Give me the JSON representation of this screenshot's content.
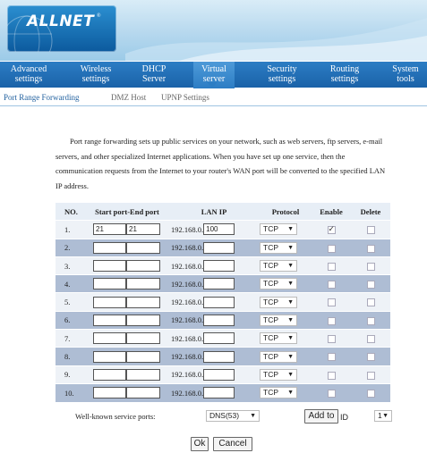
{
  "brand": {
    "name": "ALLNET",
    "reg": "®"
  },
  "nav": [
    {
      "line1": "Advanced",
      "line2": "settings"
    },
    {
      "line1": "Wireless",
      "line2": "settings"
    },
    {
      "line1": "DHCP",
      "line2": "Server"
    },
    {
      "line1": "Virtual",
      "line2": "server"
    },
    {
      "line1": "Security",
      "line2": "settings"
    },
    {
      "line1": "Routing",
      "line2": "settings"
    },
    {
      "line1": "System",
      "line2": "tools"
    }
  ],
  "subtabs": [
    "Port Range Forwarding",
    "DMZ Host",
    "UPNP Settings"
  ],
  "description": "Port range forwarding sets up public services on your network, such as web servers, ftp servers, e-mail servers, and other specialized Internet applications. When you have set up one service, then the communication requests from the Internet to your router's WAN port will be converted to the specified LAN IP address.",
  "table": {
    "headers": {
      "no": "NO.",
      "ports": "Start port-End port",
      "lan_ip": "LAN IP",
      "protocol": "Protocol",
      "enable": "Enable",
      "delete": "Delete"
    },
    "ip_prefix": "192.168.0.",
    "rows": [
      {
        "no": "1.",
        "start": "21",
        "end": "21",
        "ip": "100",
        "protocol": "TCP",
        "enabled": true
      },
      {
        "no": "2.",
        "start": "",
        "end": "",
        "ip": "",
        "protocol": "TCP",
        "enabled": false
      },
      {
        "no": "3.",
        "start": "",
        "end": "",
        "ip": "",
        "protocol": "TCP",
        "enabled": false
      },
      {
        "no": "4.",
        "start": "",
        "end": "",
        "ip": "",
        "protocol": "TCP",
        "enabled": false
      },
      {
        "no": "5.",
        "start": "",
        "end": "",
        "ip": "",
        "protocol": "TCP",
        "enabled": false
      },
      {
        "no": "6.",
        "start": "",
        "end": "",
        "ip": "",
        "protocol": "TCP",
        "enabled": false
      },
      {
        "no": "7.",
        "start": "",
        "end": "",
        "ip": "",
        "protocol": "TCP",
        "enabled": false
      },
      {
        "no": "8.",
        "start": "",
        "end": "",
        "ip": "",
        "protocol": "TCP",
        "enabled": false
      },
      {
        "no": "9.",
        "start": "",
        "end": "",
        "ip": "",
        "protocol": "TCP",
        "enabled": false
      },
      {
        "no": "10.",
        "start": "",
        "end": "",
        "ip": "",
        "protocol": "TCP",
        "enabled": false
      }
    ]
  },
  "well_known": {
    "label": "Well-known service ports:",
    "selected": "DNS(53)"
  },
  "add_button": "Add to",
  "id_label": "ID",
  "id_selected": "1",
  "ok_button": "Ok",
  "cancel_button": "Cancel",
  "icons": {
    "dropdown": "chevron-down-icon",
    "checkbox": "checkbox-icon"
  },
  "colors": {
    "nav_bg": "#1a62a8",
    "row_dark": "#aebdd4",
    "row_light": "#eef2f7",
    "active_subtab": "#1f5f9e"
  }
}
